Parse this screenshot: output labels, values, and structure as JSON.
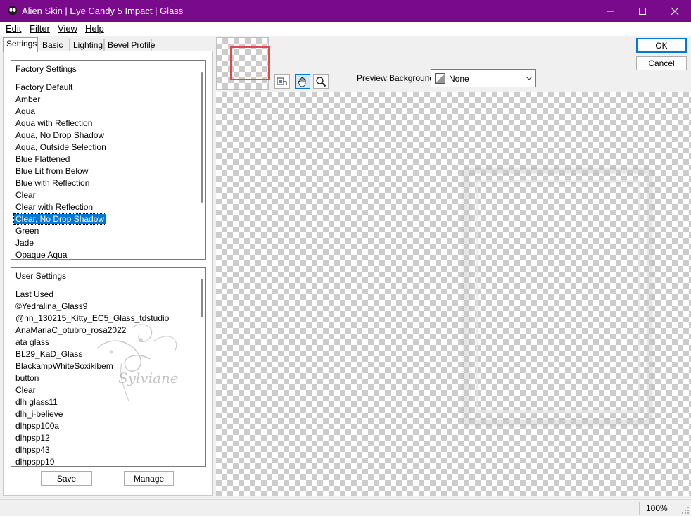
{
  "window": {
    "title": "Alien Skin | Eye Candy 5 Impact | Glass"
  },
  "menu": [
    "Edit",
    "Filter",
    "View",
    "Help"
  ],
  "tabs": [
    "Settings",
    "Basic",
    "Lighting",
    "Bevel Profile"
  ],
  "factory": {
    "header": "Factory Settings",
    "items": [
      "Factory Default",
      "Amber",
      "Aqua",
      "Aqua with Reflection",
      "Aqua, No Drop Shadow",
      "Aqua, Outside Selection",
      "Blue Flattened",
      "Blue Lit from Below",
      "Blue with Reflection",
      "Clear",
      "Clear with Reflection",
      "Clear, No Drop Shadow",
      "Green",
      "Jade",
      "Opaque Aqua"
    ],
    "selected": "Clear, No Drop Shadow"
  },
  "user": {
    "header": "User Settings",
    "items": [
      "Last Used",
      "©Yedralina_Glass9",
      "@nn_130215_Kitty_EC5_Glass_tdstudio",
      "AnaMariaC_otubro_rosa2022",
      "ata glass",
      "BL29_KaD_Glass",
      "BlackampWhiteSoxikibem",
      "button",
      "Clear",
      "dlh glass11",
      "dlh_i-believe",
      "dlhpsp100a",
      "dlhpsp12",
      "dlhpsp43",
      "dlhpspp19"
    ]
  },
  "buttons": {
    "save": "Save",
    "manage": "Manage",
    "ok": "OK",
    "cancel": "Cancel"
  },
  "preview": {
    "label": "Preview Background:",
    "value": "None"
  },
  "status": {
    "zoom": "100%"
  },
  "watermark": "Sylviane",
  "colors": {
    "titlebar": "#7a0a8c",
    "selection": "#0078d7",
    "navigator_rect": "#e34848"
  },
  "icons": [
    "app-icon",
    "minimize-icon",
    "maximize-icon",
    "close-icon",
    "navigator-toggle-icon",
    "hand-icon",
    "zoom-icon",
    "chevron-down-icon",
    "resize-grip-icon"
  ]
}
